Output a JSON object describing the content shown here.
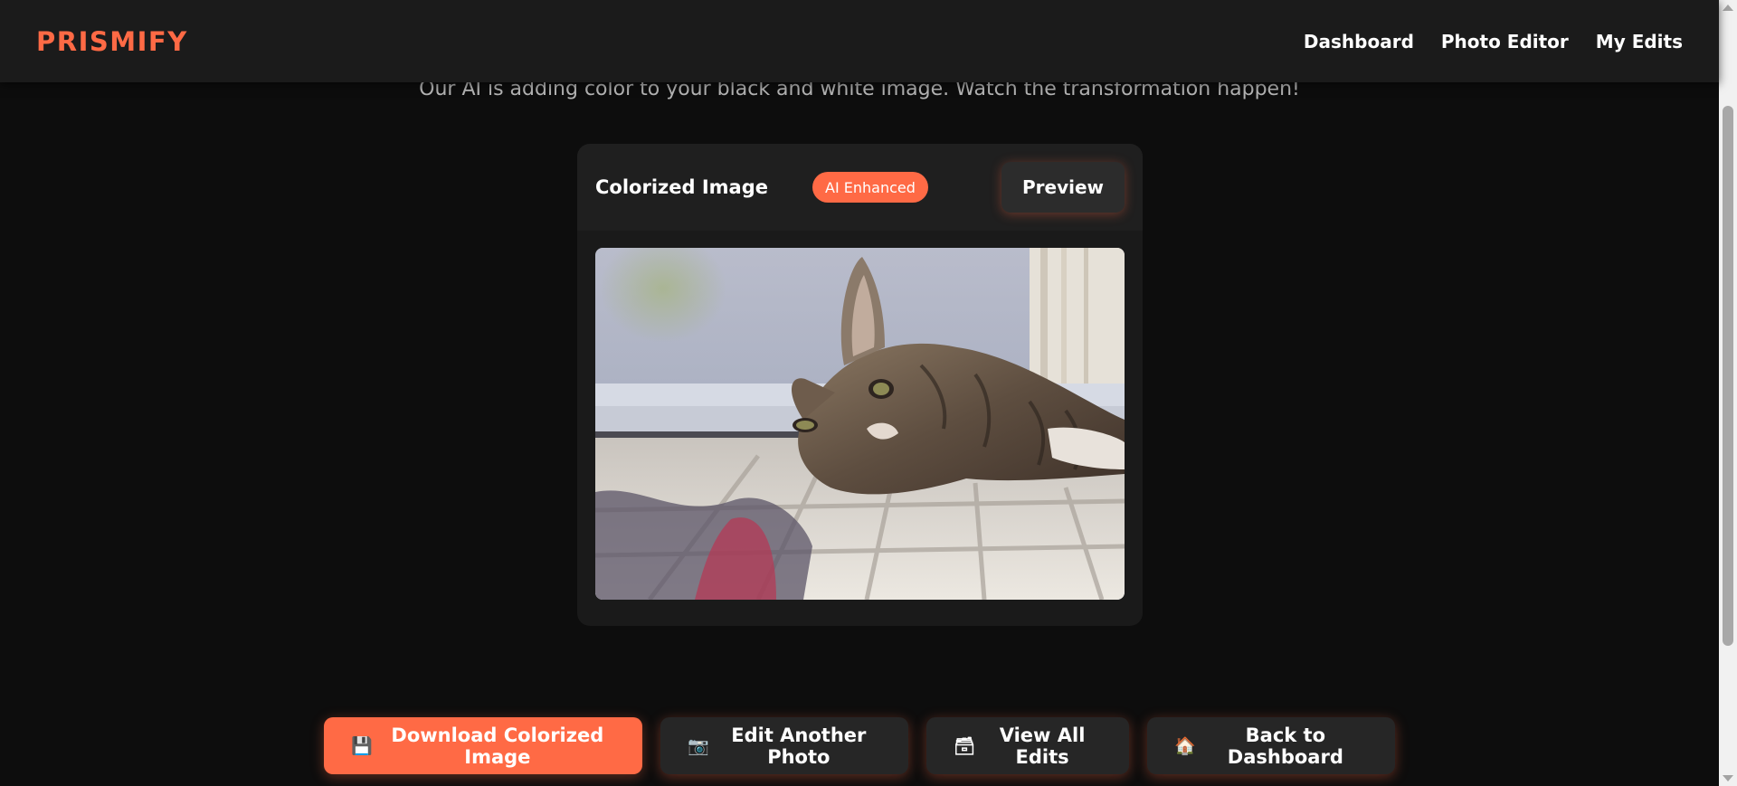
{
  "app": {
    "logo": "PRISMIFY"
  },
  "nav": {
    "items": [
      {
        "label": "Dashboard"
      },
      {
        "label": "Photo Editor"
      },
      {
        "label": "My Edits"
      }
    ]
  },
  "page": {
    "subtitle": "Our AI is adding color to your black and white image. Watch the transformation happen!"
  },
  "card": {
    "title": "Colorized Image",
    "badge": "AI Enhanced",
    "preview_label": "Preview",
    "image_alt": "Colorized photo of a tabby cat lying on the floor"
  },
  "actions": {
    "download": {
      "icon": "💾",
      "label": "Download Colorized Image"
    },
    "edit_another": {
      "icon": "📷",
      "label": "Edit Another Photo"
    },
    "view_all": {
      "icon": "🗃",
      "label": "View All Edits"
    },
    "back": {
      "icon": "🏠",
      "label": "Back to Dashboard"
    }
  },
  "colors": {
    "accent": "#ff6a45",
    "background": "#0d0d0d",
    "header": "#1b1b1b",
    "card": "#1a1a1a"
  }
}
